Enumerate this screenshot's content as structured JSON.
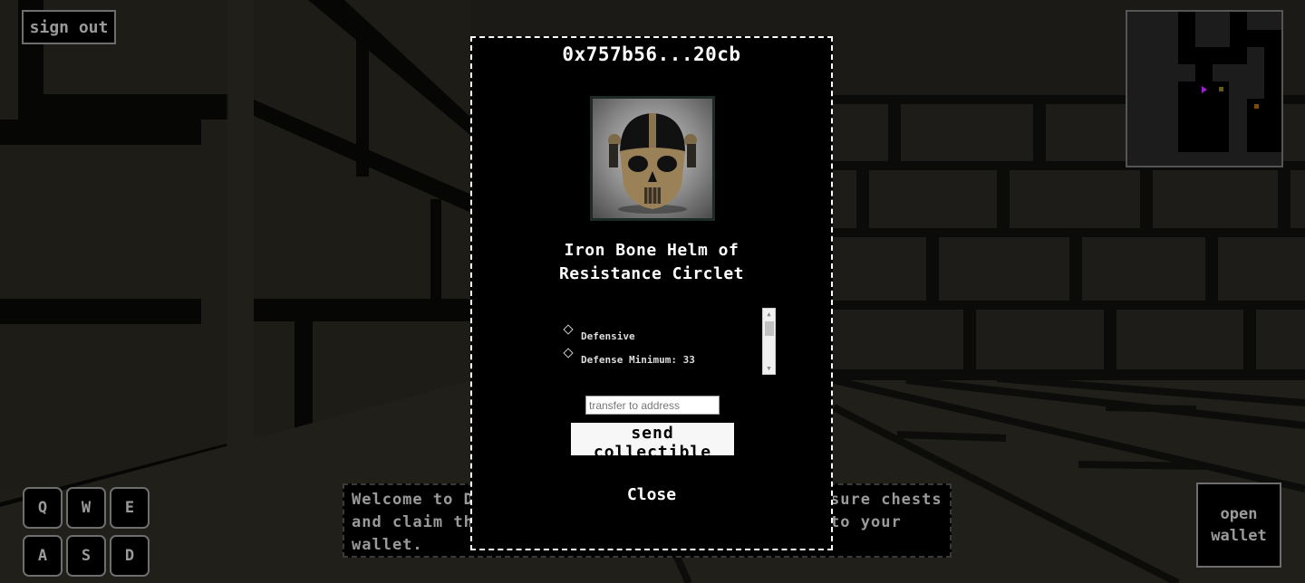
{
  "header": {
    "sign_out_label": "sign out"
  },
  "controls": {
    "keys": [
      "Q",
      "W",
      "E",
      "A",
      "S",
      "D"
    ]
  },
  "message": {
    "text": "Welcome to Dungeon! Explore the maze, find treasure chests and claim them to receive a unique collectible to your wallet."
  },
  "wallet": {
    "open_label": "open wallet"
  },
  "modal": {
    "title": "0x757b56...20cb",
    "item_name_line1": "Iron Bone Helm of",
    "item_name_line2": "Resistance Circlet",
    "image_icon": "skull-helm-icon",
    "attributes": [
      "Defensive",
      "Defense Minimum: 33"
    ],
    "transfer_placeholder": "transfer to address",
    "transfer_value": "",
    "send_label": "send collectible",
    "close_label": "Close"
  },
  "minimap": {
    "player_color": "#9b20d0",
    "chest_color": "#6e5a10",
    "item_color": "#7a4a10"
  },
  "colors": {
    "ui_bg": "#000000",
    "ui_text": "#9a9a9a",
    "ui_border": "#6e6e6e",
    "wall": "#2a2820"
  }
}
